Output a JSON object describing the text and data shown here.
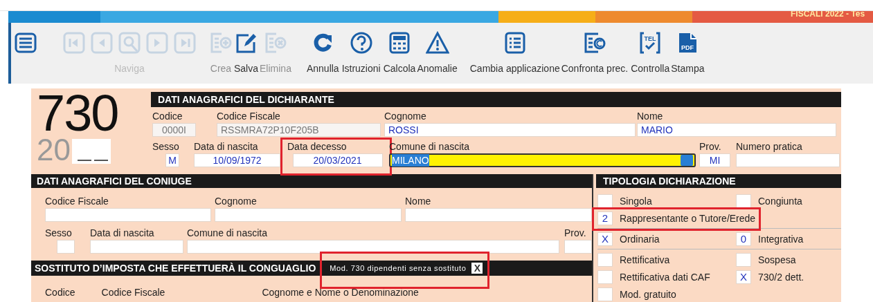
{
  "header": {
    "title": "FISCALI 2022 - Tes"
  },
  "toolbar": {
    "menu": {
      "kind": "menu"
    },
    "navigation": {
      "label": "Naviga",
      "disabled": true,
      "buttons": [
        {
          "kind": "first"
        },
        {
          "kind": "previous"
        },
        {
          "kind": "search"
        },
        {
          "kind": "next"
        },
        {
          "kind": "last"
        }
      ]
    },
    "buttons": [
      {
        "kind": "create",
        "label": "Crea",
        "disabled": true
      },
      {
        "kind": "save",
        "label": "Salva",
        "disabled": false
      },
      {
        "kind": "delete",
        "label": "Elimina",
        "disabled": true
      },
      {
        "kind": "undo",
        "label": "Annulla",
        "disabled": false
      },
      {
        "kind": "help",
        "label": "Istruzioni",
        "disabled": false
      },
      {
        "kind": "calculator",
        "label": "Calcola",
        "disabled": false
      },
      {
        "kind": "warning",
        "label": "Anomalie",
        "disabled": false
      },
      {
        "kind": "list",
        "label": "Cambia applicazione",
        "disabled": false
      },
      {
        "kind": "compare",
        "label": "Confronta prec.",
        "disabled": false
      },
      {
        "kind": "tel",
        "label": "Controlla",
        "disabled": false,
        "icon_text": "TEL"
      },
      {
        "kind": "pdf",
        "label": "Stampa",
        "disabled": false,
        "icon_text": "PDF"
      }
    ]
  },
  "form": {
    "model": "730",
    "year": "20",
    "dichiarante": {
      "title": "DATI ANAGRAFICI DEL DICHIARANTE",
      "line_1": [
        {
          "label": "Codice",
          "value": "0000I",
          "disabled": true,
          "focused": false,
          "highlighted": false
        },
        {
          "label": "Codice Fiscale",
          "value": "RSSMRA72P10F205B",
          "disabled": true,
          "focused": false,
          "highlighted": false
        },
        {
          "label": "Cognome",
          "value": "ROSSI",
          "disabled": false,
          "focused": false,
          "highlighted": false
        },
        {
          "label": "Nome",
          "value": "MARIO",
          "disabled": false,
          "focused": false,
          "highlighted": false
        }
      ],
      "line_2": [
        {
          "label": "Sesso",
          "value": "M",
          "disabled": false,
          "focused": false,
          "highlighted": false
        },
        {
          "label": "Data di nascita",
          "value": "10/09/1972",
          "disabled": false,
          "focused": false,
          "highlighted": false
        },
        {
          "label": "Data decesso",
          "value": "20/03/2021",
          "disabled": false,
          "focused": false,
          "highlighted": true
        },
        {
          "label": "Comune di nascita",
          "value": "MILANO",
          "disabled": false,
          "focused": true,
          "highlighted": false
        },
        {
          "label": "Prov.",
          "value": "MI",
          "disabled": false,
          "focused": false,
          "highlighted": false
        },
        {
          "label": "Numero pratica",
          "disabled": false,
          "focused": false,
          "highlighted": false
        }
      ]
    },
    "coniuge": {
      "title": "DATI ANAGRAFICI DEL CONIUGE",
      "line_1": [
        {
          "label": "Codice Fiscale"
        },
        {
          "label": "Cognome"
        },
        {
          "label": "Nome"
        }
      ],
      "line_2": [
        {
          "label": "Sesso"
        },
        {
          "label": "Data di nascita"
        },
        {
          "label": "Comune di nascita"
        },
        {
          "label": "Prov."
        }
      ]
    },
    "sostituto": {
      "title": "SOSTITUTO D’IMPOSTA CHE EFFETTUERÀ IL CONGUAGLIO",
      "option": {
        "label": "Mod. 730 dipendenti senza sostituto",
        "value": "X",
        "highlighted": true
      },
      "columns": [
        "Codice",
        "Codice Fiscale",
        "Cognome e Nome o Denominazione"
      ]
    },
    "tipologia": {
      "title": "TIPOLOGIA DICHIARAZIONE",
      "sections": [
        {
          "rows": [
            {
              "options": [
                {
                  "label": "Singola",
                  "highlighted": false
                },
                {
                  "label": "Congiunta",
                  "highlighted": false
                }
              ]
            },
            {
              "options": [
                {
                  "label": "Rappresentante o Tutore/Erede",
                  "value": "2",
                  "highlighted": true
                }
              ]
            }
          ]
        },
        {
          "rows": [
            {
              "options": [
                {
                  "label": "Ordinaria",
                  "value": "X",
                  "highlighted": false
                },
                {
                  "label": "Integrativa",
                  "value": "0",
                  "highlighted": false
                }
              ]
            }
          ]
        },
        {
          "rows": [
            {
              "options": [
                {
                  "label": "Rettificativa",
                  "highlighted": false
                },
                {
                  "label": "Sospesa",
                  "highlighted": false
                }
              ]
            },
            {
              "options": [
                {
                  "label": "Rettificativa dati CAF",
                  "highlighted": false
                },
                {
                  "label": "730/2 dett.",
                  "value": "X",
                  "highlighted": false
                }
              ]
            },
            {
              "options": [
                {
                  "label": "Mod. gratuito",
                  "highlighted": false
                }
              ]
            }
          ]
        }
      ]
    }
  }
}
